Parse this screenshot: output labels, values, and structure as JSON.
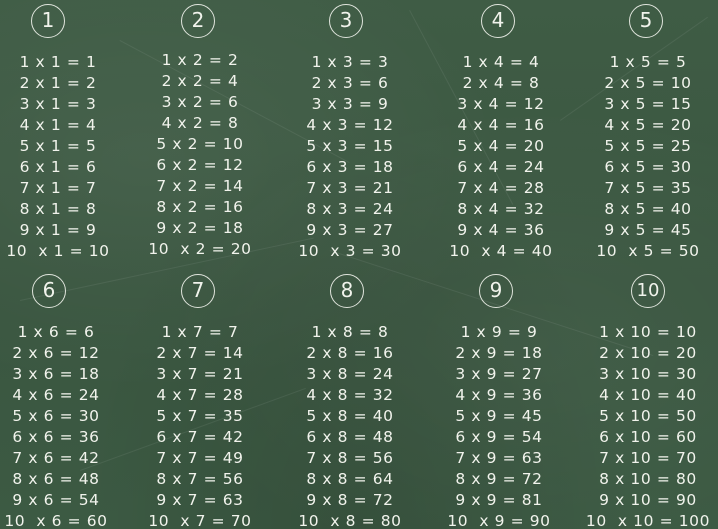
{
  "tables": [
    {
      "number": "1",
      "lines": [
        "1 x 1 = 1",
        "2 x 1 = 2",
        "3 x 1 = 3",
        "4 x 1 = 4",
        "5 x 1 = 5",
        "6 x 1 = 6",
        "7 x 1 = 7",
        "8 x 1 = 8",
        "9 x 1 = 9",
        "10  x 1 = 10"
      ]
    },
    {
      "number": "2",
      "lines": [
        "1 x 2 = 2",
        "2 x 2 = 4",
        "3 x 2 = 6",
        "4 x 2 = 8",
        "5 x 2 = 10",
        "6 x 2 = 12",
        "7 x 2 = 14",
        "8 x 2 = 16",
        "9 x 2 = 18",
        "10  x 2 = 20"
      ]
    },
    {
      "number": "3",
      "lines": [
        "1 x 3 = 3",
        "2 x 3 = 6",
        "3 x 3 = 9",
        "4 x 3 = 12",
        "5 x 3 = 15",
        "6 x 3 = 18",
        "7 x 3 = 21",
        "8 x 3 = 24",
        "9 x 3 = 27",
        "10  x 3 = 30"
      ]
    },
    {
      "number": "4",
      "lines": [
        "1 x 4 = 4",
        "2 x 4 = 8",
        "3 x 4 = 12",
        "4 x 4 = 16",
        "5 x 4 = 20",
        "6 x 4 = 24",
        "7 x 4 = 28",
        "8 x 4 = 32",
        "9 x 4 = 36",
        "10  x 4 = 40"
      ]
    },
    {
      "number": "5",
      "lines": [
        "1 x 5 = 5",
        "2 x 5 = 10",
        "3 x 5 = 15",
        "4 x 5 = 20",
        "5 x 5 = 25",
        "6 x 5 = 30",
        "7 x 5 = 35",
        "8 x 5 = 40",
        "9 x 5 = 45",
        "10  x 5 = 50"
      ]
    },
    {
      "number": "6",
      "lines": [
        "1 x 6 = 6",
        "2 x 6 = 12",
        "3 x 6 = 18",
        "4 x 6 = 24",
        "5 x 6 = 30",
        "6 x 6 = 36",
        "7 x 6 = 42",
        "8 x 6 = 48",
        "9 x 6 = 54",
        "10  x 6 = 60"
      ]
    },
    {
      "number": "7",
      "lines": [
        "1 x 7 = 7",
        "2 x 7 = 14",
        "3 x 7 = 21",
        "4 x 7 = 28",
        "5 x 7 = 35",
        "6 x 7 = 42",
        "7 x 7 = 49",
        "8 x 7 = 56",
        "9 x 7 = 63",
        "10  x 7 = 70"
      ]
    },
    {
      "number": "8",
      "lines": [
        "1 x 8 = 8",
        "2 x 8 = 16",
        "3 x 8 = 24",
        "4 x 8 = 32",
        "5 x 8 = 40",
        "6 x 8 = 48",
        "7 x 8 = 56",
        "8 x 8 = 64",
        "9 x 8 = 72",
        "10  x 8 = 80"
      ]
    },
    {
      "number": "9",
      "lines": [
        "1 x 9 = 9",
        "2 x 9 = 18",
        "3 x 9 = 27",
        "4 x 9 = 36",
        "5 x 9 = 45",
        "6 x 9 = 54",
        "7 x 9 = 63",
        "8 x 9 = 72",
        "9 x 9 = 81",
        "10  x 9 = 90"
      ]
    },
    {
      "number": "10",
      "lines": [
        "1 x 10 = 10",
        "2 x 10 = 20",
        "3 x 10 = 30",
        "4 x 10 = 40",
        "5 x 10 = 50",
        "6 x 10 = 60",
        "7 x 10 = 70",
        "8 x 10 = 80",
        "9 x 10 = 90",
        "10  x 10 = 100"
      ]
    }
  ],
  "colors": {
    "board": "#3d5942",
    "chalk": "#f1f3ec"
  }
}
